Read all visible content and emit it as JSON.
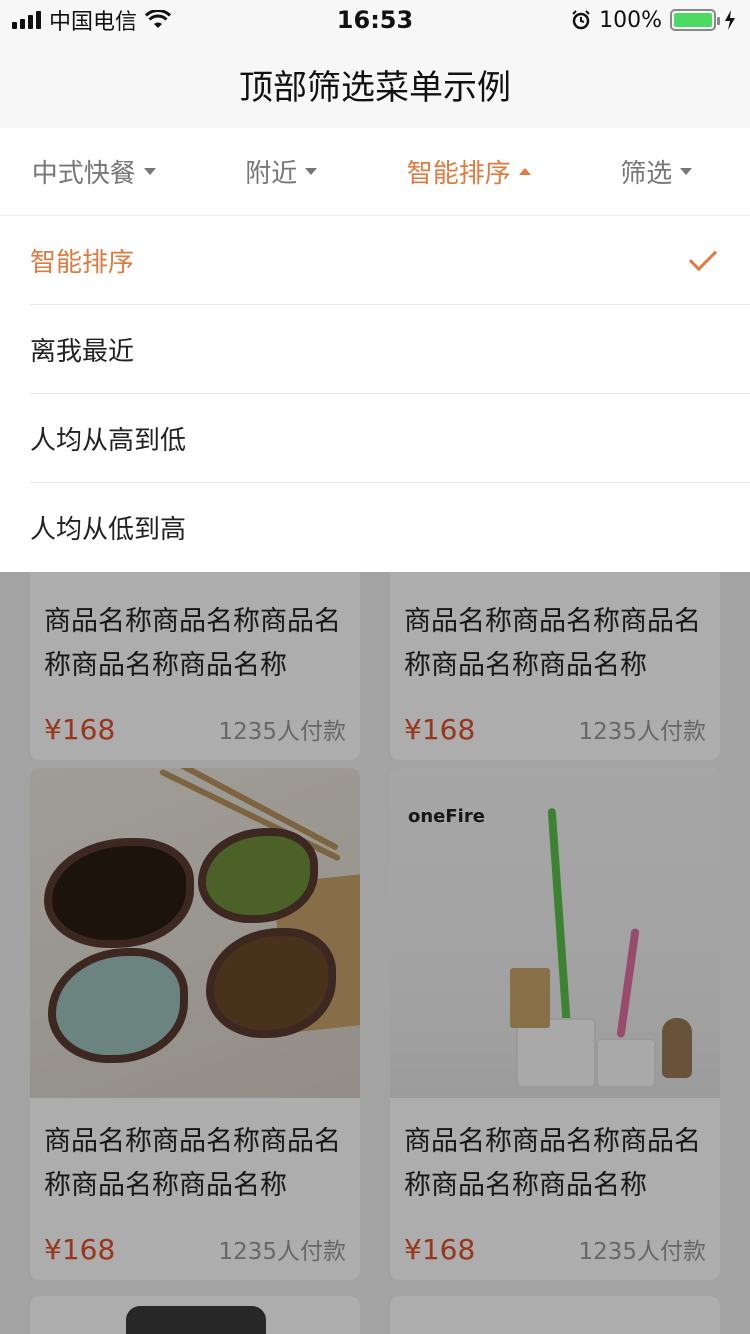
{
  "status_bar": {
    "carrier": "中国电信",
    "time": "16:53",
    "battery_percent": "100%",
    "battery_level": 1.0
  },
  "nav": {
    "title": "顶部筛选菜单示例"
  },
  "filters": [
    {
      "label": "中式快餐",
      "active": false
    },
    {
      "label": "附近",
      "active": false
    },
    {
      "label": "智能排序",
      "active": true
    },
    {
      "label": "筛选",
      "active": false
    }
  ],
  "dropdown": {
    "items": [
      {
        "label": "智能排序",
        "selected": true
      },
      {
        "label": "离我最近",
        "selected": false
      },
      {
        "label": "人均从高到低",
        "selected": false
      },
      {
        "label": "人均从低到高",
        "selected": false
      }
    ]
  },
  "products": [
    {
      "title": "商品名称商品名称商品名称商品名称商品名称",
      "price": "¥168",
      "paid": "1235人付款"
    },
    {
      "title": "商品名称商品名称商品名称商品名称商品名称",
      "price": "¥168",
      "paid": "1235人付款"
    },
    {
      "title": "商品名称商品名称商品名称商品名称商品名称",
      "price": "¥168",
      "paid": "1235人付款",
      "image": "dishes"
    },
    {
      "title": "商品名称商品名称商品名称商品名称商品名称",
      "price": "¥168",
      "paid": "1235人付款",
      "image": "lamp",
      "brand": "oneFire"
    }
  ],
  "colors": {
    "accent": "#e07a3f",
    "price": "#e0502a",
    "battery": "#4cd964"
  }
}
